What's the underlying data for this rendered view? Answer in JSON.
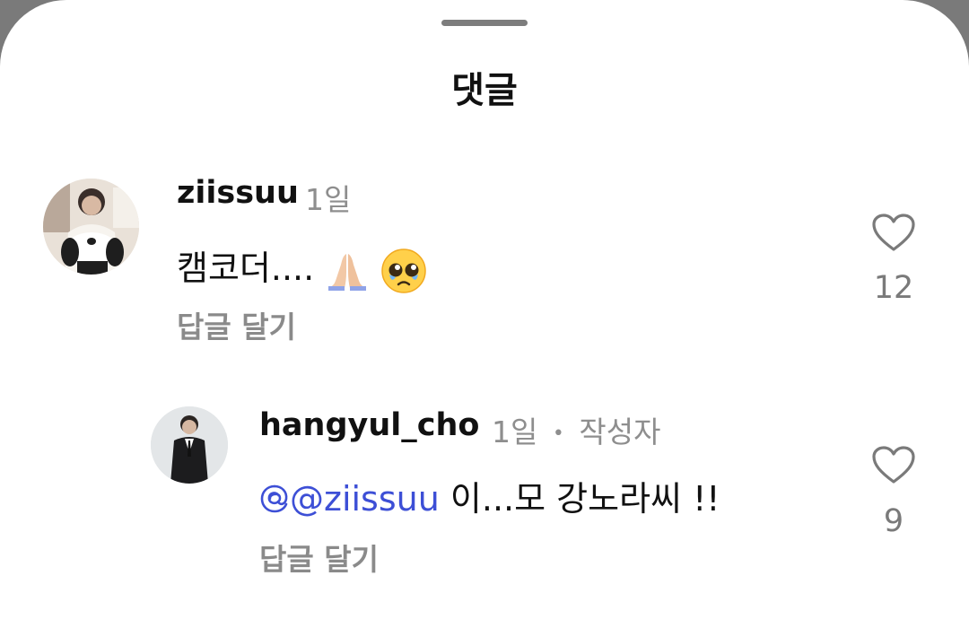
{
  "sheet": {
    "title": "댓글"
  },
  "comments": [
    {
      "username": "ziissuu",
      "time": "1일",
      "text": "캠코더....",
      "emojis": [
        "folded-hands-emoji",
        "pleading-face-emoji"
      ],
      "reply_label": "답글 달기",
      "like_count": "12"
    },
    {
      "username": "hangyul_cho",
      "time": "1일",
      "separator": "•",
      "author_badge": "작성자",
      "mention": "@ziissuu",
      "text": "이...모 강노라씨 !!",
      "reply_label": "답글 달기",
      "like_count": "9"
    }
  ],
  "colors": {
    "mention": "#3d4fd6",
    "secondary": "#8e8e8e",
    "background": "#ffffff"
  }
}
